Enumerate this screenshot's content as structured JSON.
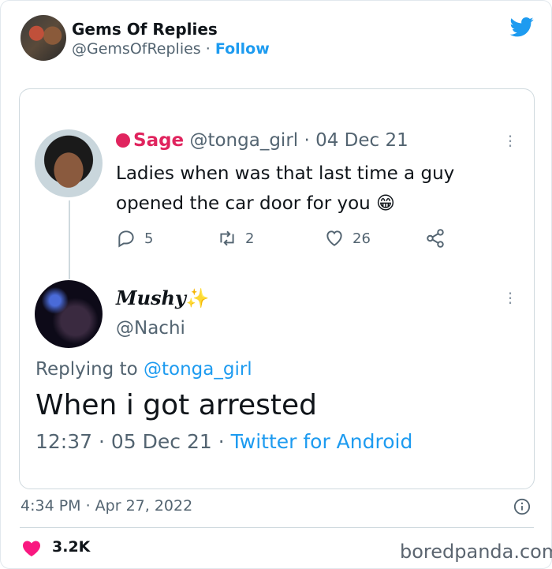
{
  "embed": {
    "author_name": "Gems Of Replies",
    "author_handle": "@GemsOfReplies",
    "separator": "·",
    "follow_label": "Follow",
    "timestamp": "4:34 PM · Apr 27, 2022",
    "like_count": "3.2K",
    "watermark": "boredpanda.com"
  },
  "tweet1": {
    "display_name": "Sage",
    "handle": "@tonga_girl",
    "date": "· 04 Dec 21",
    "text": "Ladies when was that last time a guy opened the car door for you",
    "emoji": "😁",
    "reply_count": "5",
    "retweet_count": "2",
    "like_count": "26"
  },
  "tweet2": {
    "display_name": "Mushy",
    "sparkle": "✨",
    "handle": "@Nachi",
    "replying_prefix": "Replying to ",
    "replying_to": "@tonga_girl",
    "text": "When i got arrested",
    "time_date": "12:37 · 05 Dec 21 · ",
    "source": "Twitter for Android"
  },
  "colors": {
    "accent": "#1d9bf0",
    "like_red": "#e0245e",
    "muted": "#536471"
  }
}
